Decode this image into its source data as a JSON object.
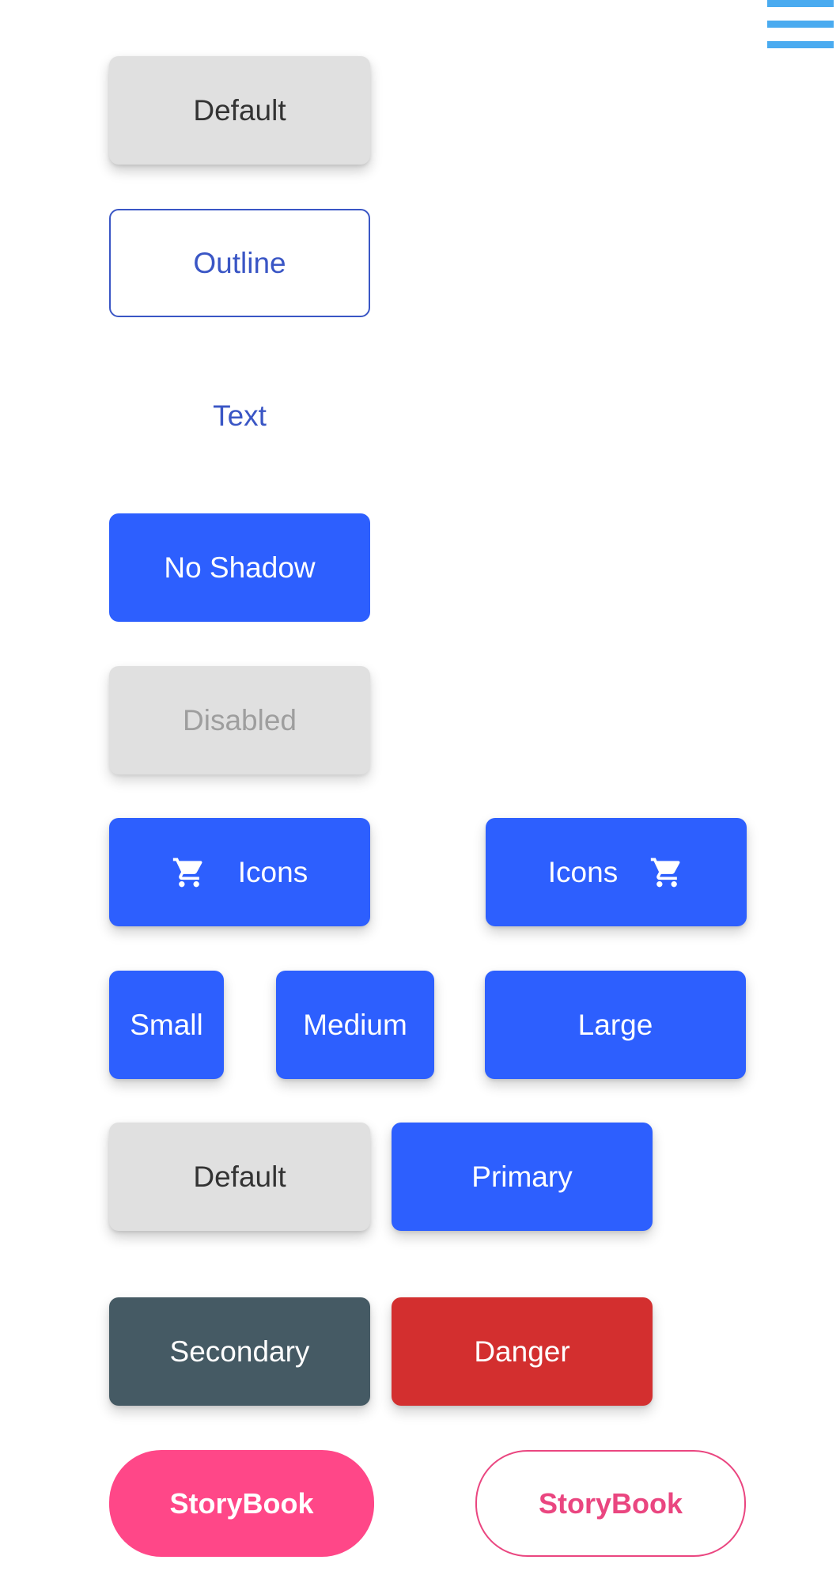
{
  "colors": {
    "primary": "#2d5ffe",
    "default_bg": "#e0e0e0",
    "outline": "#3a56c5",
    "secondary": "#455a64",
    "danger": "#d32f2f",
    "storybook": "#ff4788",
    "menu": "#4aabf0"
  },
  "header": {
    "menu_icon": "hamburger-menu-icon"
  },
  "buttons": {
    "default": "Default",
    "outline": "Outline",
    "text": "Text",
    "no_shadow": "No Shadow",
    "disabled": "Disabled",
    "icons_left": {
      "label": "Icons",
      "icon": "shopping-cart-icon"
    },
    "icons_right": {
      "label": "Icons",
      "icon": "shopping-cart-icon"
    },
    "sizes": {
      "small": "Small",
      "medium": "Medium",
      "large": "Large"
    },
    "types": {
      "default": "Default",
      "primary": "Primary",
      "secondary": "Secondary",
      "danger": "Danger"
    },
    "storybook_filled": "StoryBook",
    "storybook_outline": "StoryBook"
  }
}
